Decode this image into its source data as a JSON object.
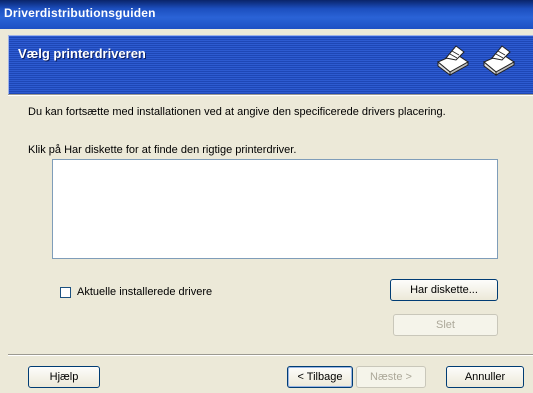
{
  "window": {
    "title": "Driverdistributionsguiden"
  },
  "header": {
    "title": "Vælg printerdriveren",
    "icons": [
      "printer-icon",
      "printer-icon"
    ],
    "background_color": "#2d5bd1"
  },
  "body": {
    "intro_text": "Du kan fortsætte med installationen ved at angive den specificerede drivers placering.",
    "instruction_text": "Klik på Har diskette for at finde den rigtige printerdriver.",
    "driver_list": {
      "items": []
    }
  },
  "checkbox": {
    "label": "Aktuelle installerede drivere",
    "checked": false
  },
  "buttons": {
    "have_disk": "Har diskette...",
    "delete": "Slet",
    "help": "Hjælp",
    "back": "< Tilbage",
    "next": "Næste >",
    "cancel": "Annuller"
  },
  "colors": {
    "titlebar": "#0a246a",
    "dialog_bg": "#ece9d8",
    "button_border": "#003c74"
  }
}
